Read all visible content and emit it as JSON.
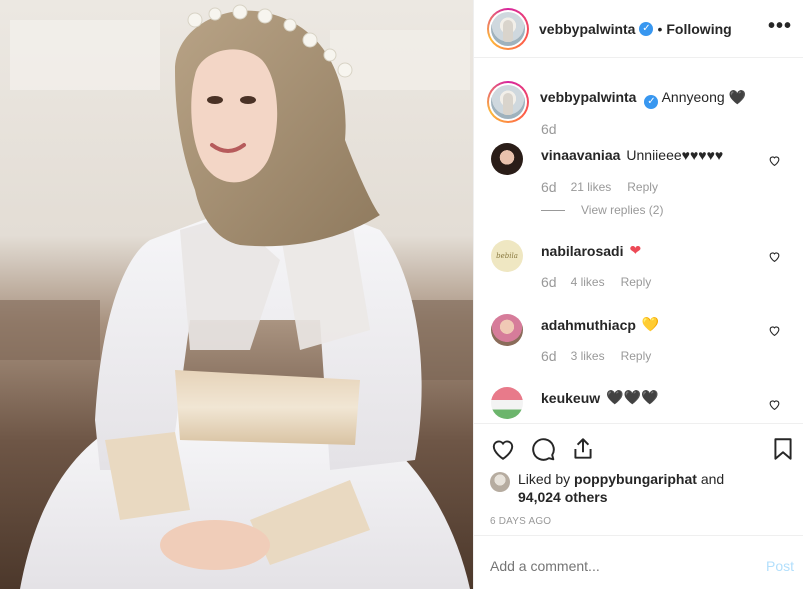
{
  "post": {
    "author": "vebbypalwinta",
    "follow_status": "Following",
    "dot": "•",
    "more_label": "•••",
    "verified_mark": "✓"
  },
  "caption": {
    "username": "vebbypalwinta",
    "text": "Annyeong",
    "emoji": "🖤",
    "time": "6d"
  },
  "comments": [
    {
      "username": "vinaavaniaa",
      "text": "Unniieee♥♥♥♥♥",
      "time": "6d",
      "likes": "21 likes",
      "reply": "Reply",
      "view_replies": "View replies (2)"
    },
    {
      "username": "nabilarosadi",
      "text": "",
      "emoji": "❤",
      "time": "6d",
      "likes": "4 likes",
      "reply": "Reply",
      "avatar_text": "bebila"
    },
    {
      "username": "adahmuthiacp",
      "text": "",
      "emoji": "💛",
      "time": "6d",
      "likes": "3 likes",
      "reply": "Reply"
    },
    {
      "username": "keukeuw",
      "text": "🖤🖤🖤"
    }
  ],
  "likes": {
    "prefix": "Liked by",
    "user": "poppybungaripha t",
    "user_display": "poppybungariphat",
    "connector": "and",
    "count": "94,024 others"
  },
  "date": "6 DAYS AGO",
  "add_comment": {
    "placeholder": "Add a comment...",
    "post_label": "Post"
  },
  "colors": {
    "verified": "#3897f0",
    "muted": "#999999",
    "post_disabled": "#b2dffc",
    "red_heart": "#ed4956",
    "yellow_heart": "#f5c518"
  }
}
